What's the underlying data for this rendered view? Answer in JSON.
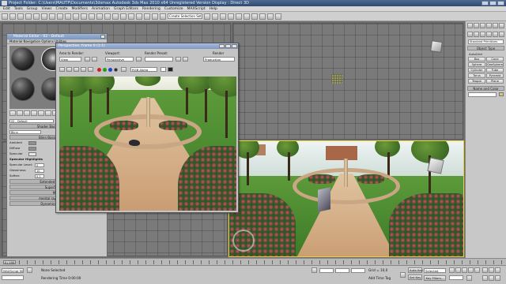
{
  "titlebar": {
    "text": "Project Folder: C:\\Users\\MAUTP\\Documents\\3dsmax   Autodesk 3ds Max 2010 x64   Unregistered Version   Display : Direct 3D"
  },
  "menubar": {
    "items": [
      "Edit",
      "Tools",
      "Group",
      "Views",
      "Create",
      "Modifiers",
      "Animation",
      "Graph Editors",
      "Rendering",
      "Customize",
      "MAXScript",
      "Help"
    ]
  },
  "toolbar": {
    "selection_set": "Create Selection Set"
  },
  "viewports": {
    "top_left_label": "",
    "perspective_label": ""
  },
  "cmdpanel": {
    "category": "Standard Primitives",
    "object_type_header": "Object Type",
    "autogrid": "AutoGrid",
    "buttons": [
      "Box",
      "Cone",
      "Sphere",
      "GeoSphere",
      "Cylinder",
      "Tube",
      "Torus",
      "Pyramid",
      "Teapot",
      "Plane"
    ],
    "name_color_header": "Name and Color"
  },
  "mateditor": {
    "title": "Material Editor - 02 - Default",
    "menu": "Material  Navigation  Options  Utilities",
    "material_name": "02 - Default",
    "material_type": "Standard",
    "shader_header": "Shader Basic Parameters",
    "shader": "Blinn",
    "blinn_header": "Blinn Basic Parameters",
    "ambient": "Ambient",
    "diffuse": "Diffuse",
    "specular": "Specular",
    "spec_highlights": "Specular Highlights",
    "spec_level_label": "Specular Level:",
    "spec_level": "0",
    "glossiness_label": "Glossiness:",
    "glossiness": "10",
    "soften_label": "Soften:",
    "soften": "0.1",
    "rollouts": [
      "Extended Parameters",
      "SuperSampling",
      "Maps",
      "mental ray Connection",
      "Dynamics Properties"
    ]
  },
  "renderwin": {
    "title": "Perspective, frame 0 (1:1)",
    "area_label": "Area to Render:",
    "area_value": "View",
    "viewport_label": "Viewport:",
    "viewport_value": "Perspective",
    "preset_label": "Render Preset:",
    "preset_value": "",
    "render_button": "Render",
    "production_value": "Production",
    "channel_value": "RGB Alpha"
  },
  "timeline": {
    "frame_slider": "0 / 100"
  },
  "statusbar": {
    "script_label": "MAXScript Mi",
    "none_selected": "None Selected",
    "rendering_time": "Rendering Time  0:00:00",
    "grid": "Grid = 10,0",
    "add_time_tag": "Add Time Tag",
    "auto_key": "Auto Key",
    "set_key": "Set Key",
    "key_mode": "Selected",
    "key_filters": "Key Filters..."
  }
}
